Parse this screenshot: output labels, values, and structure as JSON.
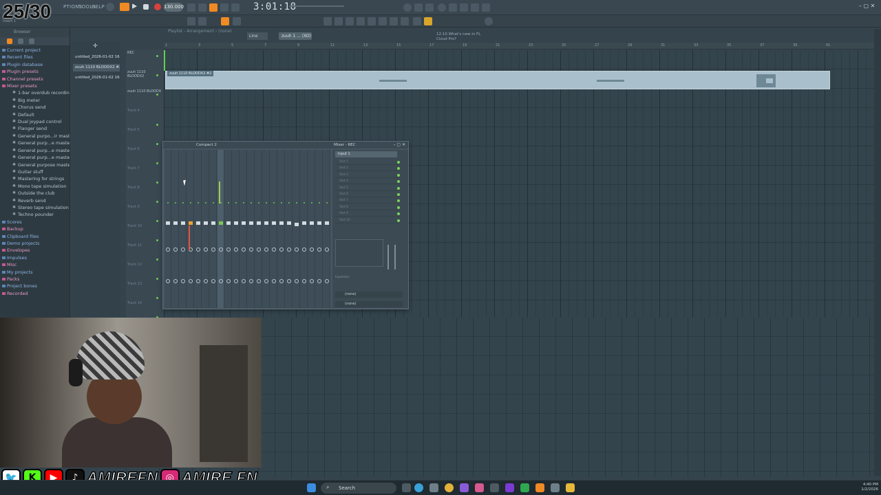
{
  "overlay": {
    "counter": "25/30"
  },
  "app": {
    "menus": [
      "PTIONS",
      "TOOLS",
      "HELP"
    ],
    "bpm": "130.000",
    "time": "3:01:18",
    "pattern": "zuuh 1 ... (XO)",
    "snap": "Line",
    "news": [
      "12:10  What's new in FL",
      "Cloud Pro?"
    ],
    "hint": "Insert 1"
  },
  "browser": {
    "title": "Browser",
    "items": [
      {
        "type": "cat",
        "label": "Current project"
      },
      {
        "type": "cat",
        "label": "Recent files"
      },
      {
        "type": "cat",
        "label": "Plugin database"
      },
      {
        "type": "cat pink",
        "label": "Plugin presets"
      },
      {
        "type": "cat pink",
        "label": "Channel presets"
      },
      {
        "type": "cat pink",
        "label": "Mixer presets"
      },
      {
        "type": "sub",
        "label": "1-bar overdub recording"
      },
      {
        "type": "sub",
        "label": "Big meter"
      },
      {
        "type": "sub",
        "label": "Chorus send"
      },
      {
        "type": "sub",
        "label": "Default"
      },
      {
        "type": "sub",
        "label": "Dual joypad control"
      },
      {
        "type": "sub",
        "label": "Flanger send"
      },
      {
        "type": "sub",
        "label": "General purpo...ir mastering"
      },
      {
        "type": "sub",
        "label": "General purp...e mastering 2"
      },
      {
        "type": "sub",
        "label": "General purp...e mastering 3"
      },
      {
        "type": "sub",
        "label": "General purp...e mastering 4"
      },
      {
        "type": "sub",
        "label": "General purpose mastering"
      },
      {
        "type": "sub",
        "label": "Guitar stuff"
      },
      {
        "type": "sub",
        "label": "Mastering for strings"
      },
      {
        "type": "sub",
        "label": "Mono tape simulation"
      },
      {
        "type": "sub",
        "label": "Outside the club"
      },
      {
        "type": "sub",
        "label": "Reverb send"
      },
      {
        "type": "sub",
        "label": "Stereo tape simulation"
      },
      {
        "type": "sub",
        "label": "Techno pounder"
      },
      {
        "type": "cat",
        "label": "Scores"
      },
      {
        "type": "cat pink",
        "label": "Backup"
      },
      {
        "type": "cat",
        "label": "Clipboard files"
      },
      {
        "type": "cat",
        "label": "Demo projects"
      },
      {
        "type": "cat pink",
        "label": "Envelopes"
      },
      {
        "type": "cat",
        "label": "Impulses"
      },
      {
        "type": "cat pink",
        "label": "Misc"
      },
      {
        "type": "cat",
        "label": "My projects"
      },
      {
        "type": "cat pink",
        "label": "Packs"
      },
      {
        "type": "cat",
        "label": "Project bones"
      },
      {
        "type": "cat pink",
        "label": "Recorded"
      }
    ]
  },
  "patterns": [
    {
      "label": "untitled_2026-01-02 16-"
    },
    {
      "label": "zuuh 1110 BLOODX2 #2"
    },
    {
      "label": "untitled_2026-01-02 16-"
    }
  ],
  "playlist": {
    "title": "Playlist - Arrangement › (none)",
    "tracks": [
      "REC",
      "zuuh 1110 BLOODX2",
      "zuuh 1110 BLOODX",
      "Track 4",
      "Track 5",
      "Track 6",
      "Track 7",
      "Track 8",
      "Track 9",
      "Track 10",
      "Track 11",
      "Track 12",
      "Track 13",
      "Track 14"
    ],
    "ruler": [
      "1",
      "3",
      "5",
      "7",
      "9",
      "11",
      "13",
      "15",
      "17",
      "19",
      "21",
      "23",
      "25",
      "27",
      "29",
      "31",
      "33",
      "35",
      "37",
      "39",
      "41"
    ],
    "clip_label": "zuuh 1110 BLOODX2 #2"
  },
  "mixer": {
    "title": "Compact 2",
    "insert_title": "Mixer - REC",
    "input": "Input 1",
    "slots": [
      "Slot 1",
      "Slot 2",
      "Slot 3",
      "Slot 4",
      "Slot 5",
      "Slot 6",
      "Slot 7",
      "Slot 8",
      "Slot 9",
      "Slot 10"
    ],
    "eq_label": "Equalizer",
    "out1": "(none)",
    "out2": "(none)"
  },
  "socials": {
    "handle1": "AMIREFN",
    "handle2": "AMIRE.FN"
  },
  "taskbar": {
    "search": "Search",
    "time": "4:40 PM",
    "date": "1/2/2026"
  }
}
